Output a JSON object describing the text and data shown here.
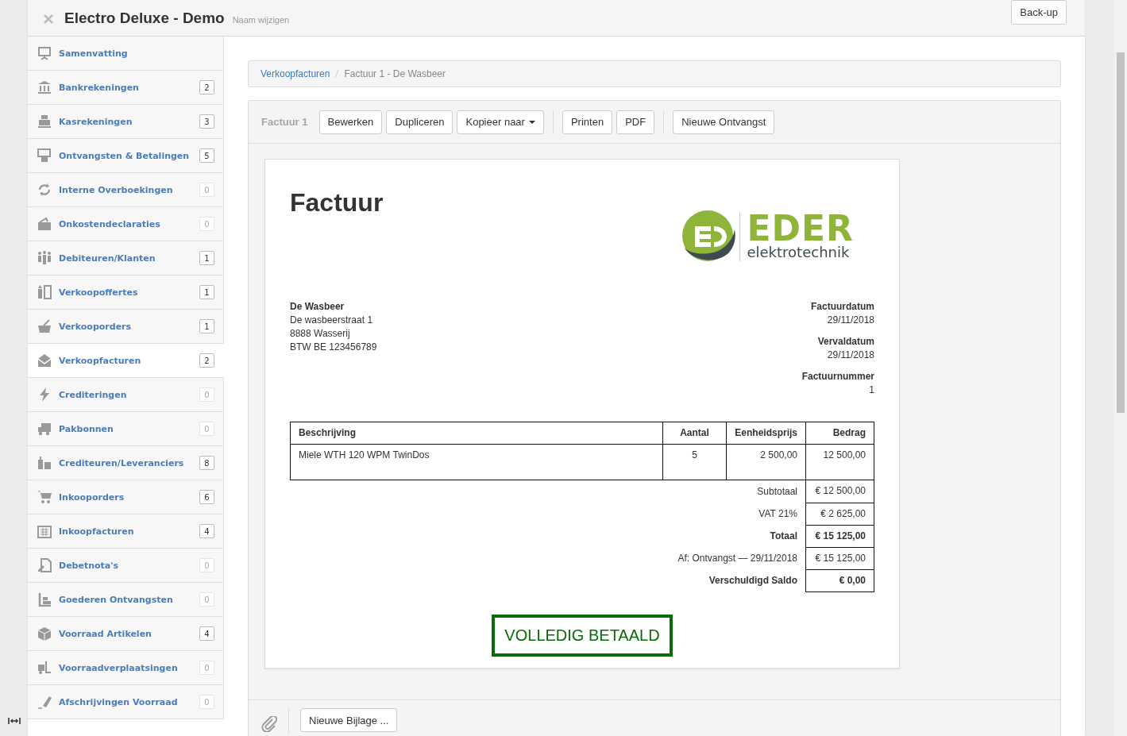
{
  "app": {
    "title": "Electro Deluxe - Demo",
    "rename_link": "Naam wijzigen",
    "backup_button": "Back-up"
  },
  "sidebar": {
    "items": [
      {
        "label": "Samenvatting",
        "selected": false
      },
      {
        "label": "Bankrekeningen",
        "count": "2",
        "muted": false,
        "selected": false
      },
      {
        "label": "Kasrekeningen",
        "count": "3",
        "muted": false,
        "selected": false
      },
      {
        "label": "Ontvangsten & Betalingen",
        "count": "5",
        "muted": false,
        "selected": false
      },
      {
        "label": "Interne Overboekingen",
        "count": "0",
        "muted": true,
        "selected": false
      },
      {
        "label": "Onkostendeclaraties",
        "count": "0",
        "muted": true,
        "selected": false
      },
      {
        "label": "Debiteuren/Klanten",
        "count": "1",
        "muted": false,
        "selected": false
      },
      {
        "label": "Verkoopoffertes",
        "count": "1",
        "muted": false,
        "selected": false
      },
      {
        "label": "Verkooporders",
        "count": "1",
        "muted": false,
        "selected": false
      },
      {
        "label": "Verkoopfacturen",
        "count": "2",
        "muted": false,
        "selected": true
      },
      {
        "label": "Crediteringen",
        "count": "0",
        "muted": true,
        "selected": false
      },
      {
        "label": "Pakbonnen",
        "count": "0",
        "muted": true,
        "selected": false
      },
      {
        "label": "Crediteuren/Leveranciers",
        "count": "8",
        "muted": false,
        "selected": false
      },
      {
        "label": "Inkooporders",
        "count": "6",
        "muted": false,
        "selected": false
      },
      {
        "label": "Inkoopfacturen",
        "count": "4",
        "muted": false,
        "selected": false
      },
      {
        "label": "Debetnota's",
        "count": "0",
        "muted": true,
        "selected": false
      },
      {
        "label": "Goederen Ontvangsten",
        "count": "0",
        "muted": true,
        "selected": false
      },
      {
        "label": "Voorraad Artikelen",
        "count": "4",
        "muted": false,
        "selected": false
      },
      {
        "label": "Voorraadverplaatsingen",
        "count": "0",
        "muted": true,
        "selected": false
      },
      {
        "label": "Afschrijvingen Voorraad",
        "count": "0",
        "muted": true,
        "selected": false
      }
    ]
  },
  "breadcrumb": [
    {
      "label": "Verkoopfacturen",
      "kind": "link"
    },
    {
      "label": "Factuur 1 - De Wasbeer",
      "kind": "current"
    }
  ],
  "toolbar": {
    "title": "Factuur 1",
    "groups": [
      [
        {
          "label": "Bewerken",
          "dropdown": false
        },
        {
          "label": "Dupliceren",
          "dropdown": false
        },
        {
          "label": "Kopieer naar",
          "dropdown": true
        }
      ],
      [
        {
          "label": "Printen",
          "dropdown": false
        },
        {
          "label": "PDF",
          "dropdown": false
        }
      ],
      [
        {
          "label": "Nieuwe Ontvangst",
          "dropdown": false
        }
      ]
    ]
  },
  "invoice": {
    "heading": "Factuur",
    "logo": {
      "name": "EDER",
      "tagline": "elektrotechnik"
    },
    "customer": {
      "name": "De Wasbeer",
      "lines": [
        "De wasbeerstraat 1",
        "8888 Wasserij",
        "BTW BE 123456789"
      ]
    },
    "meta": [
      {
        "label": "Factuurdatum",
        "value": "29/11/2018"
      },
      {
        "label": "Vervaldatum",
        "value": "29/11/2018"
      },
      {
        "label": "Factuurnummer",
        "value": "1"
      }
    ],
    "table": {
      "columns": [
        "Beschrijving",
        "Aantal",
        "Eenheidsprijs",
        "Bedrag"
      ],
      "rows": [
        [
          "Miele WTH 120 WPM TwinDos",
          "5",
          "2 500,00",
          "12 500,00"
        ]
      ]
    },
    "totals": [
      {
        "label": "Subtotaal",
        "value": "€ 12 500,00",
        "bold": false
      },
      {
        "label": "VAT 21%",
        "value": "€ 2 625,00",
        "bold": false
      },
      {
        "label": "Totaal",
        "value": "€ 15 125,00",
        "bold": true
      },
      {
        "label": "Af: Ontvangst — 29/11/2018",
        "value": "€ 15 125,00",
        "bold": false
      },
      {
        "label": "Verschuldigd Saldo",
        "value": "€ 0,00",
        "bold": true
      }
    ],
    "stamp": "VOLLEDIG BETAALD"
  },
  "attachments": {
    "button": "Nieuwe Bijlage ..."
  }
}
